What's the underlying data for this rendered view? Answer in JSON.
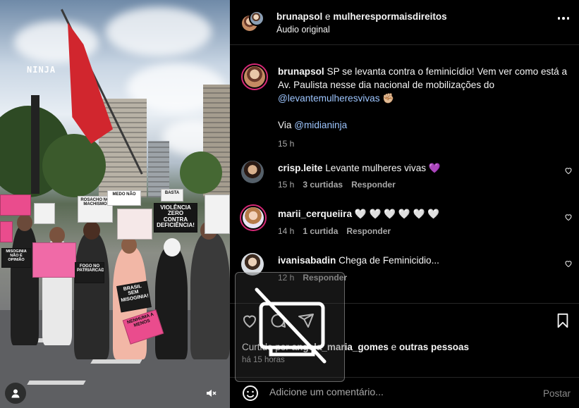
{
  "media": {
    "watermark": "NINJA",
    "signs": {
      "sign_1": "MISOGINIA NÃO É OPINIÃO",
      "sign_2": "FOGO NO PATRIARCADO",
      "sign_3": "VIOLÊNCIA ZERO CONTRA DEFICIÊNCIA!",
      "sign_4": "BRASIL SEM MISOGINIA!",
      "sign_5": "NENHUMA A MENOS",
      "sign_6": "BASTA",
      "sign_7": "MEDO NÃO",
      "sign_8": "ROSACHO NO MACHISMO"
    },
    "mute_icon": "speaker-muted-icon",
    "user_icon": "user-tag-icon"
  },
  "header": {
    "account_1": "brunapsol",
    "connector": "e",
    "account_2": "mulherespormaisdireitos",
    "audio": "Áudio original",
    "more_icon": "more-options-icon"
  },
  "caption": {
    "username": "brunapsol",
    "text_part_1": "SP se levanta contra o feminicídio! Vem ver como está a Av. Paulista nesse dia nacional de mobilizações do",
    "mention_1": "@levantemulheresvivas",
    "emoji": "✊🏼",
    "via": "Via",
    "mention_2": "@midianinja",
    "time": "15 h"
  },
  "comments": [
    {
      "username": "crisp.leite",
      "text": "Levante mulheres vivas 💜",
      "time": "15 h",
      "likes": "3 curtidas",
      "reply": "Responder"
    },
    {
      "username": "marii_cerqueiira",
      "text": "🤍 🤍 🤍 🤍 🤍 🤍",
      "time": "14 h",
      "likes": "1 curtida",
      "reply": "Responder"
    },
    {
      "username": "ivanisabadin",
      "text": "Chega de Feminicidio...",
      "time": "12 h",
      "likes": "",
      "reply": "Responder"
    }
  ],
  "actions": {
    "like_icon": "heart-icon",
    "comment_icon": "comment-icon",
    "share_icon": "share-icon",
    "save_icon": "bookmark-icon",
    "liked_by_prefix": "Curtido por",
    "liked_by_user": "angela_maria_gomes",
    "liked_by_connector": "e",
    "liked_by_others": "outras pessoas",
    "posted_ago": "há 15 horas"
  },
  "composer": {
    "emoji_icon": "emoji-icon",
    "placeholder": "Adicione um comentário...",
    "post_label": "Postar"
  },
  "colors": {
    "background": "#000000",
    "text": "#f5f5f5",
    "muted": "#a8a8a8",
    "link": "#9ec6ff",
    "story_ring": "#d62976",
    "flag_red": "#d1262e"
  }
}
